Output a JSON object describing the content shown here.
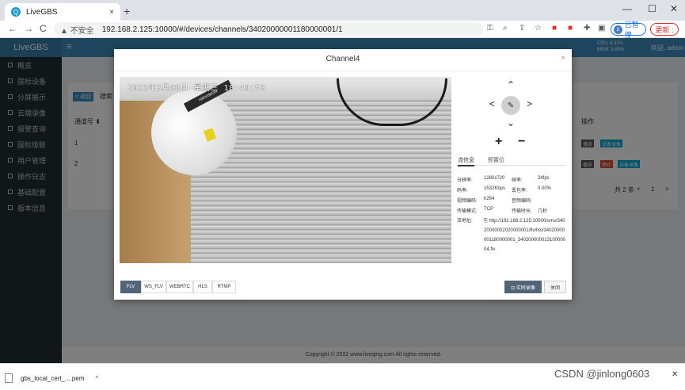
{
  "browser": {
    "tab_title": "LiveGBS",
    "tab_close": "×",
    "new_tab": "+",
    "win_min": "—",
    "win_max": "☐",
    "win_close": "✕",
    "back": "←",
    "forward": "→",
    "reload": "C",
    "security": "▲ 不安全",
    "url": "192.168.2.125:10000/#/devices/channels/34020000001180000001/1",
    "profile_label": "已暂停",
    "update_label": "更新 :"
  },
  "app": {
    "logo": "LiveGBS",
    "sidebar": [
      {
        "label": "概览"
      },
      {
        "label": "国标设备"
      },
      {
        "label": "分屏展示"
      },
      {
        "label": "云端录像"
      },
      {
        "label": "报警查询"
      },
      {
        "label": "国标级联"
      },
      {
        "label": "用户管理"
      },
      {
        "label": "操作日志"
      },
      {
        "label": "基础配置"
      },
      {
        "label": "版本信息"
      }
    ],
    "menu_icon": "≡",
    "stat1": "CPU: 8.31%",
    "stat2": "MEM: 8.83%",
    "user": "欢迎, admin",
    "back_button": "< 返回",
    "search_label": "搜索",
    "col_channel": "通道号 ⬍",
    "col_action": "操作",
    "rows": [
      {
        "num": "1"
      },
      {
        "num": "2"
      }
    ],
    "action_play": "播放",
    "action_rec": "设备录像",
    "action_stop": "停止",
    "pager_total": "共 2 条",
    "pager_page": "1",
    "pager_prev": "<",
    "pager_next": ">",
    "footer": "Copyright © 2022 www.liveqing.com All rights reserved."
  },
  "modal": {
    "title": "Channel4",
    "close": "×",
    "osd": "2023年3月08日  星期三 18:40:59",
    "cam_brand": "HIKVISION",
    "ptz_up": "⌃",
    "ptz_down": "⌄",
    "ptz_left": "<",
    "ptz_right": ">",
    "ptz_center": "✎",
    "zoom_in": "+",
    "zoom_out": "−",
    "tab_stream": "流信息",
    "tab_preset": "预置位",
    "info": {
      "res_label": "分辨率:",
      "res_value": "1280x720",
      "fps_label": "帧率:",
      "fps_value": "34fps",
      "bitrate_label": "码率:",
      "bitrate_value": "1532Kbps",
      "loss_label": "丢包率:",
      "loss_value": "0.00%",
      "vcodec_label": "视频编码:",
      "vcodec_value": "h264",
      "acodec_label": "音频编码:",
      "acodec_value": "",
      "trans_label": "传输模式:",
      "trans_value": "TCP",
      "dur_label": "传输时长:",
      "dur_value": "几秒",
      "url_label": "流地址:",
      "url_value": "⎘ http://192.168.2.125:10000/sms/34020000002020000001/flv/hls/34020000001180000001_34020000001310000004.flv"
    },
    "formats": [
      "FLV",
      "WS_FLV",
      "WEBRTC",
      "HLS",
      "RTMP"
    ],
    "rec_button": "⊡ 实时录像",
    "close_button": "关闭"
  },
  "download": {
    "file": "gbs_local_cert_....pem",
    "chevron": "^",
    "close": "✕"
  },
  "watermark": "CSDN @jinlong0603"
}
